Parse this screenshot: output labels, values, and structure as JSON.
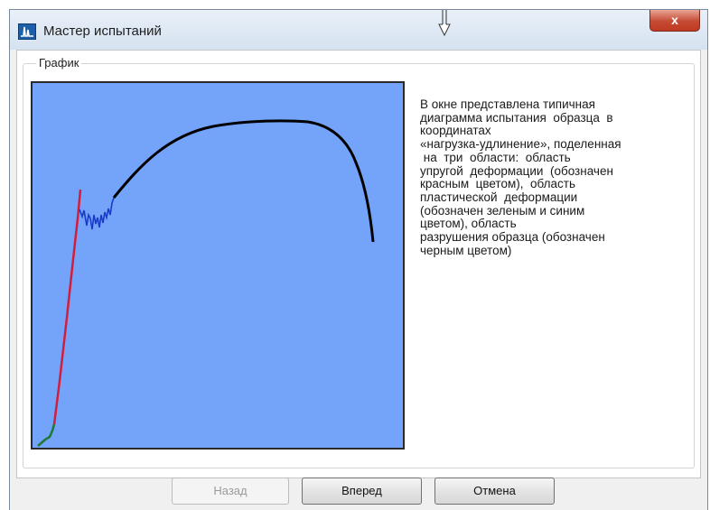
{
  "window": {
    "title": "Мастер испытаний",
    "close_label": "x"
  },
  "group": {
    "label": "График"
  },
  "description": "В окне представлена типичная\nдиаграмма испытания  образца  в\nкоординатах\n«нагрузка-удлинение», поделенная\n на  три  области:  область\nупругой  деформации  (обозначен\nкрасным  цветом),  область\nпластической  деформации\n(обозначен зеленым и синим\nцветом), область\nразрушения образца (обозначен\nчерным цветом)",
  "buttons": {
    "back": "Назад",
    "next": "Вперед",
    "cancel": "Отмена"
  },
  "colors": {
    "plot_background": "#74a4fa",
    "elastic_region": "#d21e3c",
    "plastic_region_green": "#1e7a32",
    "plastic_region_blue": "#1a3cc8",
    "fracture_region": "#000000"
  },
  "icons": {
    "app": "app-logo-icon",
    "close": "close-icon",
    "cursor": "cursor-arrow-icon"
  }
}
